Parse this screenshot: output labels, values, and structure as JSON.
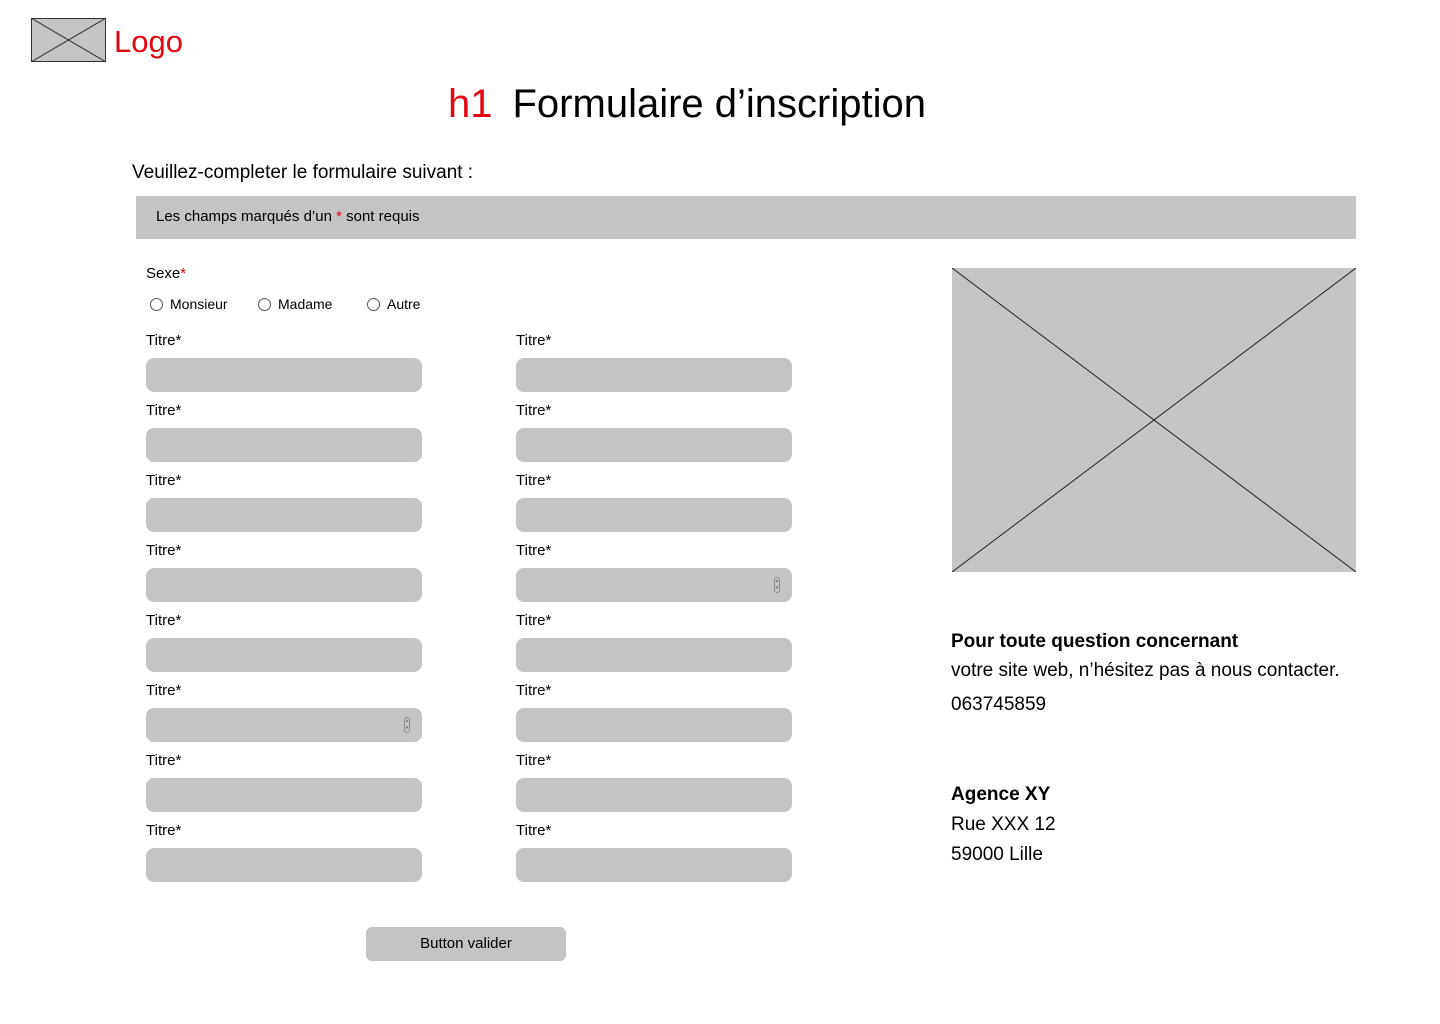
{
  "header": {
    "logo_label": "Logo",
    "heading_tag": "h1",
    "title": "Formulaire d’inscription"
  },
  "intro_text": "Veuillez-completer le formulaire suivant :",
  "notice": {
    "before": "Les champs marqués d’un ",
    "star": "*",
    "after": " sont requis"
  },
  "gender": {
    "label": "Sexe",
    "required_mark": "*",
    "options": [
      "Monsieur",
      "Madame",
      "Autre"
    ]
  },
  "fields": [
    {
      "label": "Titre*"
    },
    {
      "label": "Titre*"
    },
    {
      "label": "Titre*"
    },
    {
      "label": "Titre*"
    },
    {
      "label": "Titre*"
    },
    {
      "label": "Titre*"
    },
    {
      "label": "Titre*"
    },
    {
      "label": "Titre*",
      "type": "number"
    },
    {
      "label": "Titre*"
    },
    {
      "label": "Titre*"
    },
    {
      "label": "Titre*",
      "type": "number"
    },
    {
      "label": "Titre*"
    },
    {
      "label": "Titre*"
    },
    {
      "label": "Titre*"
    },
    {
      "label": "Titre*"
    },
    {
      "label": "Titre*"
    }
  ],
  "submit_label": "Button valider",
  "contact": {
    "heading": "Pour toute question concernant",
    "text": "votre site web, n’hésitez pas à nous contacter.",
    "phone": "063745859"
  },
  "agency": {
    "name": "Agence XY",
    "street": "Rue XXX 12",
    "city": "59000 Lille"
  },
  "colors": {
    "accent_red": "#e30613",
    "placeholder_gray": "#c4c4c4"
  }
}
